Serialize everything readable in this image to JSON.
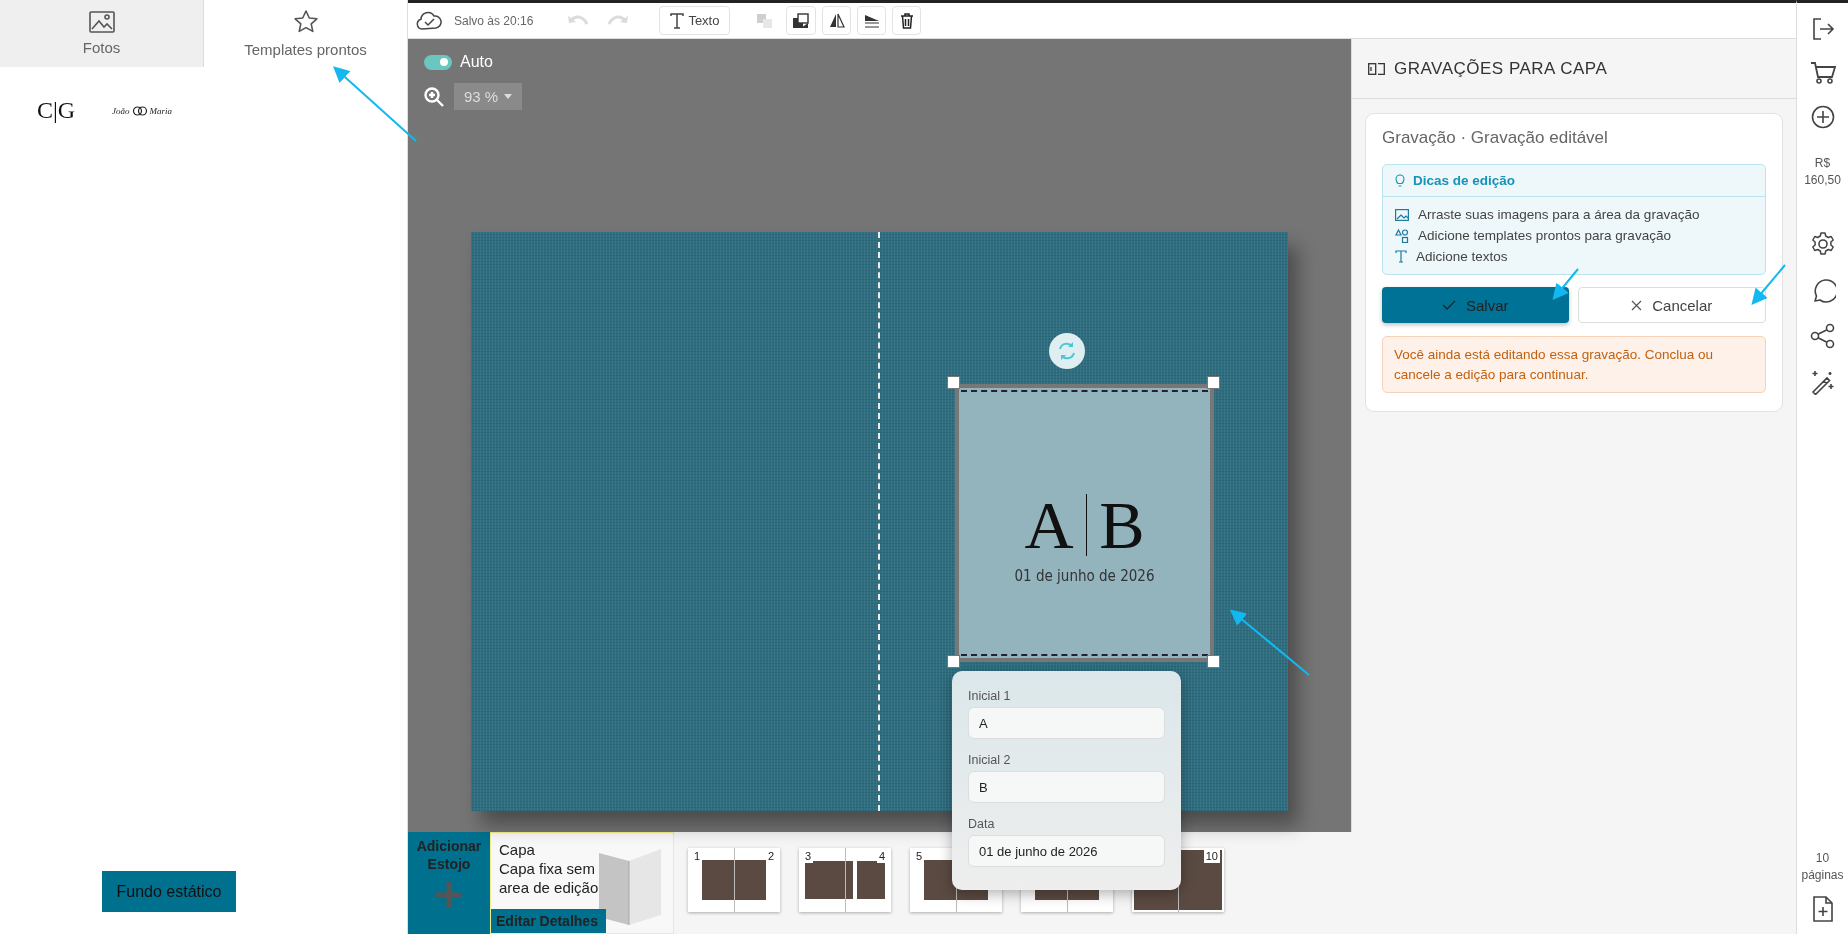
{
  "left_panel": {
    "tabs": [
      {
        "label": "Fotos",
        "kind": "photos",
        "selected": false
      },
      {
        "label": "Templates prontos",
        "kind": "star",
        "selected": true
      }
    ],
    "templates": [
      {
        "kind": "monogram",
        "text": "C|G"
      },
      {
        "kind": "names",
        "name_1": "João",
        "name_2": "Maria"
      }
    ],
    "background_button": "Fundo estático"
  },
  "toolbar": {
    "saved": "Salvo às 20:16",
    "tools": [
      {
        "kind": "undo",
        "disabled": true
      },
      {
        "kind": "redo",
        "disabled": true
      },
      {
        "kind": "text",
        "label": "Texto",
        "disabled": false
      },
      {
        "kind": "swap",
        "disabled": true
      },
      {
        "kind": "layers",
        "disabled": false
      },
      {
        "kind": "flip",
        "disabled": false
      },
      {
        "kind": "align",
        "disabled": false
      },
      {
        "kind": "delete",
        "disabled": false
      }
    ]
  },
  "canvas": {
    "auto_toggle": {
      "label": "Auto",
      "on": true
    },
    "zoom": "93 %",
    "engraving": {
      "initial_1": "A",
      "initial_2": "B",
      "date": "01 de junho de 2026"
    },
    "popup": {
      "fields": [
        {
          "label": "Inicial 1",
          "value": "A"
        },
        {
          "label": "Inicial 2",
          "value": "B"
        },
        {
          "label": "Data",
          "value": "01 de junho de 2026"
        }
      ]
    }
  },
  "right_panel": {
    "title": "GRAVAÇÕES PARA CAPA",
    "card_title": "Gravação · Gravação editável",
    "tips": {
      "title": "Dicas de edição",
      "items": [
        {
          "kind": "image",
          "text": "Arraste suas imagens para a área da gravação"
        },
        {
          "kind": "shapes",
          "text": "Adicione templates prontos para gravação"
        },
        {
          "kind": "text",
          "text": "Adicione textos"
        }
      ]
    },
    "save_button": "Salvar",
    "cancel_button": "Cancelar",
    "warning": "Você ainda está editando essa gravação. Conclua ou cancele a edição para continuar."
  },
  "sidebar": {
    "price_currency": "R$",
    "price_value": "160,50",
    "pages_count": "10",
    "pages_label": "páginas"
  },
  "bottom_strip": {
    "add_case": "Adicionar Estojo",
    "cover_title": "Capa",
    "cover_desc": "Capa fixa sem area de edição",
    "edit_details": "Editar Detalhes",
    "spreads": [
      {
        "kind": "single-photo",
        "left_page": "1",
        "right_page": "2"
      },
      {
        "kind": "collage",
        "left_page": "3",
        "right_page": "4"
      },
      {
        "kind": "single-photo",
        "left_page": "5"
      },
      {
        "kind": "single-photo"
      },
      {
        "kind": "grid",
        "right_page": "10"
      }
    ]
  }
}
